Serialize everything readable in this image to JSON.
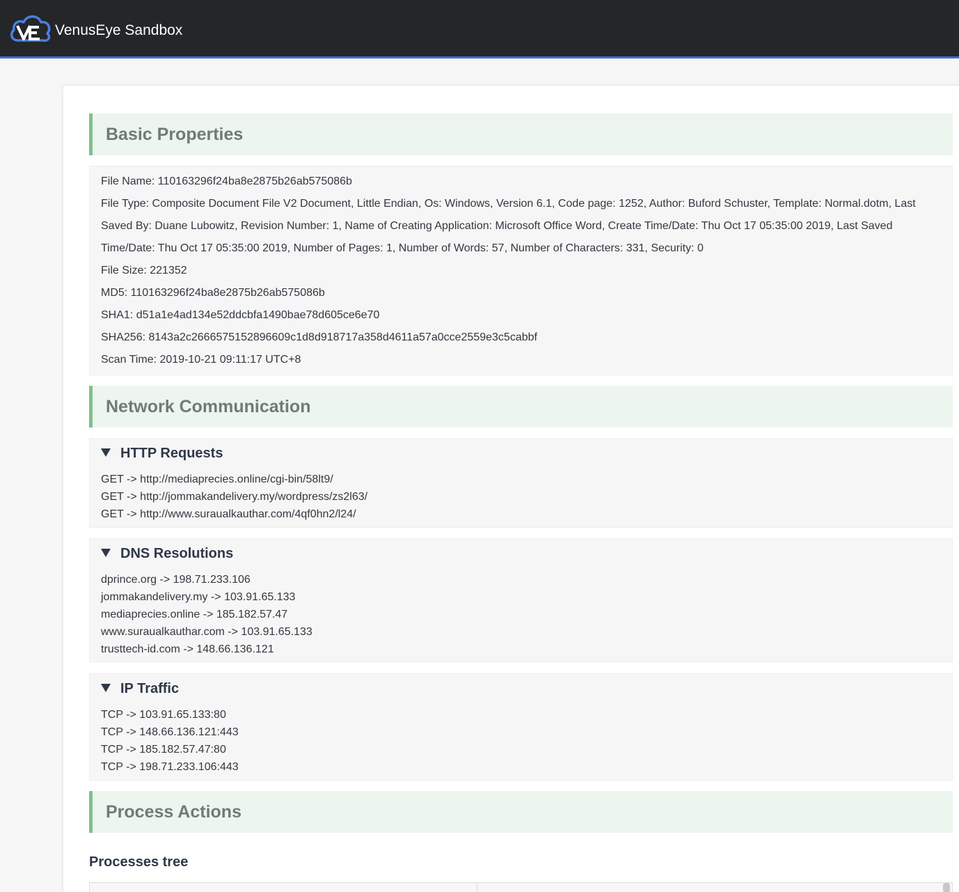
{
  "header": {
    "brand": "VenusEye Sandbox",
    "logo_icon": "venuseye-cloud-logo",
    "accent": "#3d6fd0"
  },
  "basic": {
    "title": "Basic Properties",
    "file_name": "File Name: 110163296f24ba8e2875b26ab575086b",
    "file_type": "File Type: Composite Document File V2 Document, Little Endian, Os: Windows, Version 6.1, Code page: 1252, Author: Buford Schuster, Template: Normal.dotm, Last Saved By: Duane Lubowitz, Revision Number: 1, Name of Creating Application: Microsoft Office Word, Create Time/Date: Thu Oct 17 05:35:00 2019, Last Saved Time/Date: Thu Oct 17 05:35:00 2019, Number of Pages: 1, Number of Words: 57, Number of Characters: 331, Security: 0",
    "file_size": "File Size: 221352",
    "md5": "MD5: 110163296f24ba8e2875b26ab575086b",
    "sha1": "SHA1: d51a1e4ad134e52ddcbfa1490bae78d605ce6e70",
    "sha256": "SHA256: 8143a2c2666575152896609c1d8d918717a358d4611a57a0cce2559e3c5cabbf",
    "scan_time": "Scan Time: 2019-10-21 09:11:17 UTC+8"
  },
  "network": {
    "title": "Network Communication",
    "http": {
      "title": "HTTP Requests",
      "items": [
        "GET -> http://mediaprecies.online/cgi-bin/58lt9/",
        "GET -> http://jommakandelivery.my/wordpress/zs2l63/",
        "GET -> http://www.suraualkauthar.com/4qf0hn2/l24/"
      ]
    },
    "dns": {
      "title": "DNS Resolutions",
      "items": [
        "dprince.org -> 198.71.233.106",
        "jommakandelivery.my -> 103.91.65.133",
        "mediaprecies.online -> 185.182.57.47",
        "www.suraualkauthar.com -> 103.91.65.133",
        "trusttech-id.com -> 148.66.136.121"
      ]
    },
    "ip": {
      "title": "IP Traffic",
      "items": [
        "TCP -> 103.91.65.133:80",
        "TCP -> 148.66.136.121:443",
        "TCP -> 185.182.57.47:80",
        "TCP -> 198.71.233.106:443"
      ]
    }
  },
  "process": {
    "title": "Process Actions",
    "tree_title": "Processes tree"
  }
}
